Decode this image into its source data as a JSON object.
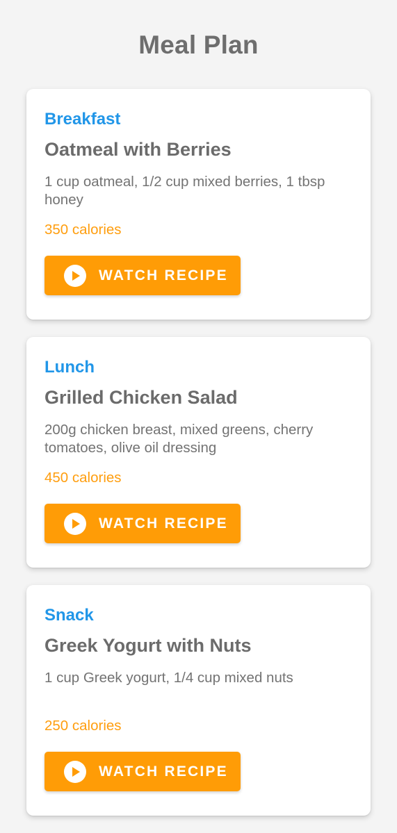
{
  "header": {
    "title": "Meal Plan"
  },
  "meals": [
    {
      "type": "Breakfast",
      "name": "Oatmeal with Berries",
      "description": "1 cup oatmeal, 1/2 cup mixed berries, 1 tbsp honey",
      "calories": "350 calories",
      "button_label": "WATCH RECIPE",
      "button_icon": "play-circle-icon"
    },
    {
      "type": "Lunch",
      "name": "Grilled Chicken Salad",
      "description": "200g chicken breast, mixed greens, cherry tomatoes, olive oil dressing",
      "calories": "450 calories",
      "button_label": "WATCH RECIPE",
      "button_icon": "play-circle-icon"
    },
    {
      "type": "Snack",
      "name": "Greek Yogurt with Nuts",
      "description": "1 cup Greek yogurt, 1/4 cup mixed nuts",
      "calories": "250 calories",
      "button_label": "WATCH RECIPE",
      "button_icon": "play-circle-icon"
    }
  ],
  "colors": {
    "background": "#f4f4f4",
    "meal_type": "#2196e8",
    "calories": "#ff9e0f",
    "button": "#ff9c06",
    "title_text": "#6e6e6e"
  }
}
